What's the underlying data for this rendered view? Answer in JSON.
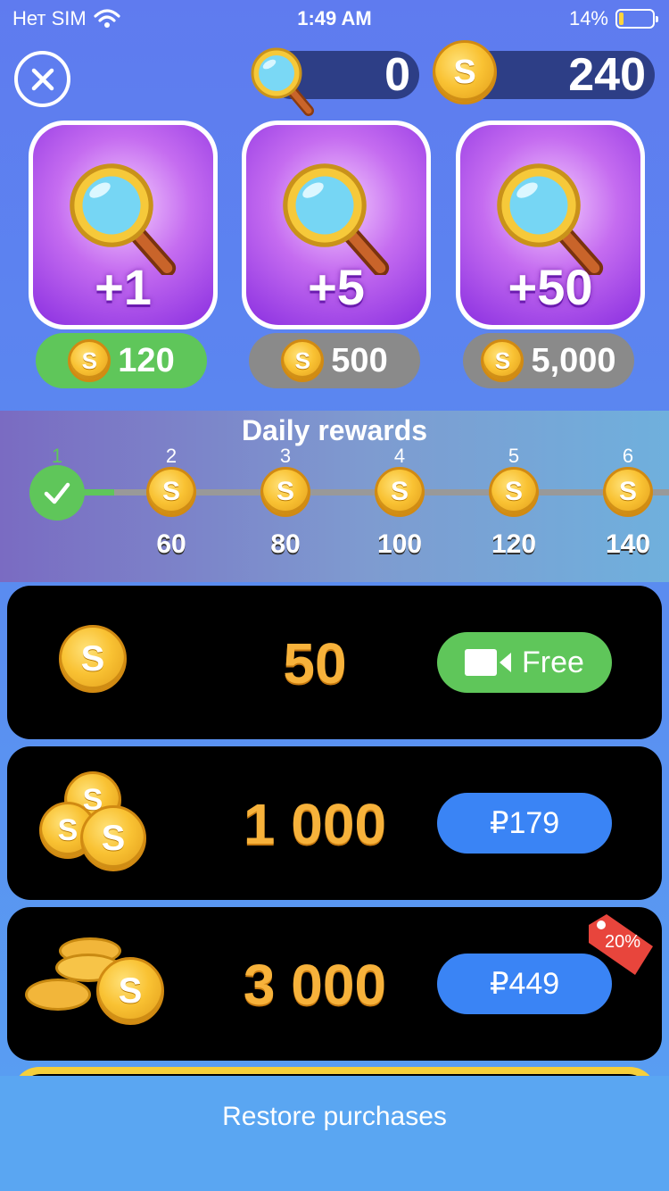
{
  "status_bar": {
    "carrier": "Нет SIM",
    "time": "1:49 AM",
    "battery": "14%",
    "battery_level": 0.14
  },
  "header": {
    "hints_count": "0",
    "coins_count": "240"
  },
  "hint_packs": [
    {
      "label": "+1",
      "price": "120",
      "price_bg": "#5fc65a"
    },
    {
      "label": "+5",
      "price": "500",
      "price_bg": "#8a8a8a"
    },
    {
      "label": "+50",
      "price": "5,000",
      "price_bg": "#8a8a8a"
    }
  ],
  "daily_rewards": {
    "title": "Daily rewards",
    "days": [
      {
        "day": "1",
        "amount": "",
        "claimed": true
      },
      {
        "day": "2",
        "amount": "60"
      },
      {
        "day": "3",
        "amount": "80"
      },
      {
        "day": "4",
        "amount": "100"
      },
      {
        "day": "5",
        "amount": "120"
      },
      {
        "day": "6",
        "amount": "140"
      }
    ]
  },
  "offers": [
    {
      "amount": "50",
      "button": "Free",
      "button_color": "#5fc65a",
      "icon": "video-camera-icon"
    },
    {
      "amount": "1 000",
      "button": "₽179",
      "button_color": "#3a84f5"
    },
    {
      "amount": "3 000",
      "button": "₽449",
      "button_color": "#3a84f5",
      "badge": "20%"
    }
  ],
  "footer": {
    "restore": "Restore purchases"
  },
  "colors": {
    "accent_green": "#5fc65a",
    "accent_blue": "#3a84f5",
    "coin_gold": "#f7b23b",
    "badge_red": "#e8453c"
  }
}
